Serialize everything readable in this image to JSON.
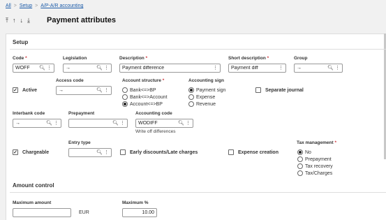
{
  "breadcrumb": {
    "all": "All",
    "setup": "Setup",
    "current": "A/P-A/R accounting",
    "sep": ">"
  },
  "toolbar": {
    "icon1": "⤒",
    "icon2": "↑",
    "icon3": "↓",
    "icon4": "⤓"
  },
  "page": {
    "title": "Payment attributes"
  },
  "setup": {
    "title": "Setup",
    "code": {
      "label": "Code",
      "value": "WOFF"
    },
    "legislation": {
      "label": "Legislation",
      "value": "→"
    },
    "description": {
      "label": "Description",
      "value": "Payment difference"
    },
    "short_description": {
      "label": "Short description",
      "value": "Payment diff"
    },
    "group": {
      "label": "Group",
      "value": "→"
    },
    "active": {
      "label": "Active",
      "checked": true
    },
    "access_code": {
      "label": "Access code",
      "value": "→"
    },
    "account_structure": {
      "label": "Account structure",
      "options": [
        "Bank<=>BP",
        "Bank<=>Account",
        "Account<=>BP"
      ],
      "selected": 2
    },
    "accounting_sign": {
      "label": "Accounting sign",
      "options": [
        "Payment sign",
        "Expense",
        "Revenue"
      ],
      "selected": 0
    },
    "separate_journal": {
      "label": "Separate journal",
      "checked": false
    },
    "interbank_code": {
      "label": "Interbank code",
      "value": "→"
    },
    "prepayment": {
      "label": "Prepayment",
      "value": ""
    },
    "accounting_code": {
      "label": "Accounting code",
      "value": "WODIFF",
      "note": "Write off differences"
    },
    "chargeable": {
      "label": "Chargeable",
      "checked": true
    },
    "entry_type": {
      "label": "Entry type",
      "value": ""
    },
    "early_discounts": {
      "label": "Early discounts/Late charges",
      "checked": false
    },
    "expense_creation": {
      "label": "Expense creation",
      "checked": false
    },
    "tax_management": {
      "label": "Tax management",
      "options": [
        "No",
        "Prepayment",
        "Tax recovery",
        "Tax/Charges"
      ],
      "selected": 0
    }
  },
  "amount_control": {
    "title": "Amount control",
    "maximum_amount": {
      "label": "Maximum amount",
      "value": "",
      "currency": "EUR"
    },
    "maximum_pct": {
      "label": "Maximum %",
      "value": "10.00"
    }
  },
  "icons": {
    "search": "search-icon",
    "menu": "more-vertical-icon",
    "check": "✓",
    "required": "*"
  },
  "colors": {
    "link": "#1a5aa8",
    "required": "#d0333a"
  }
}
